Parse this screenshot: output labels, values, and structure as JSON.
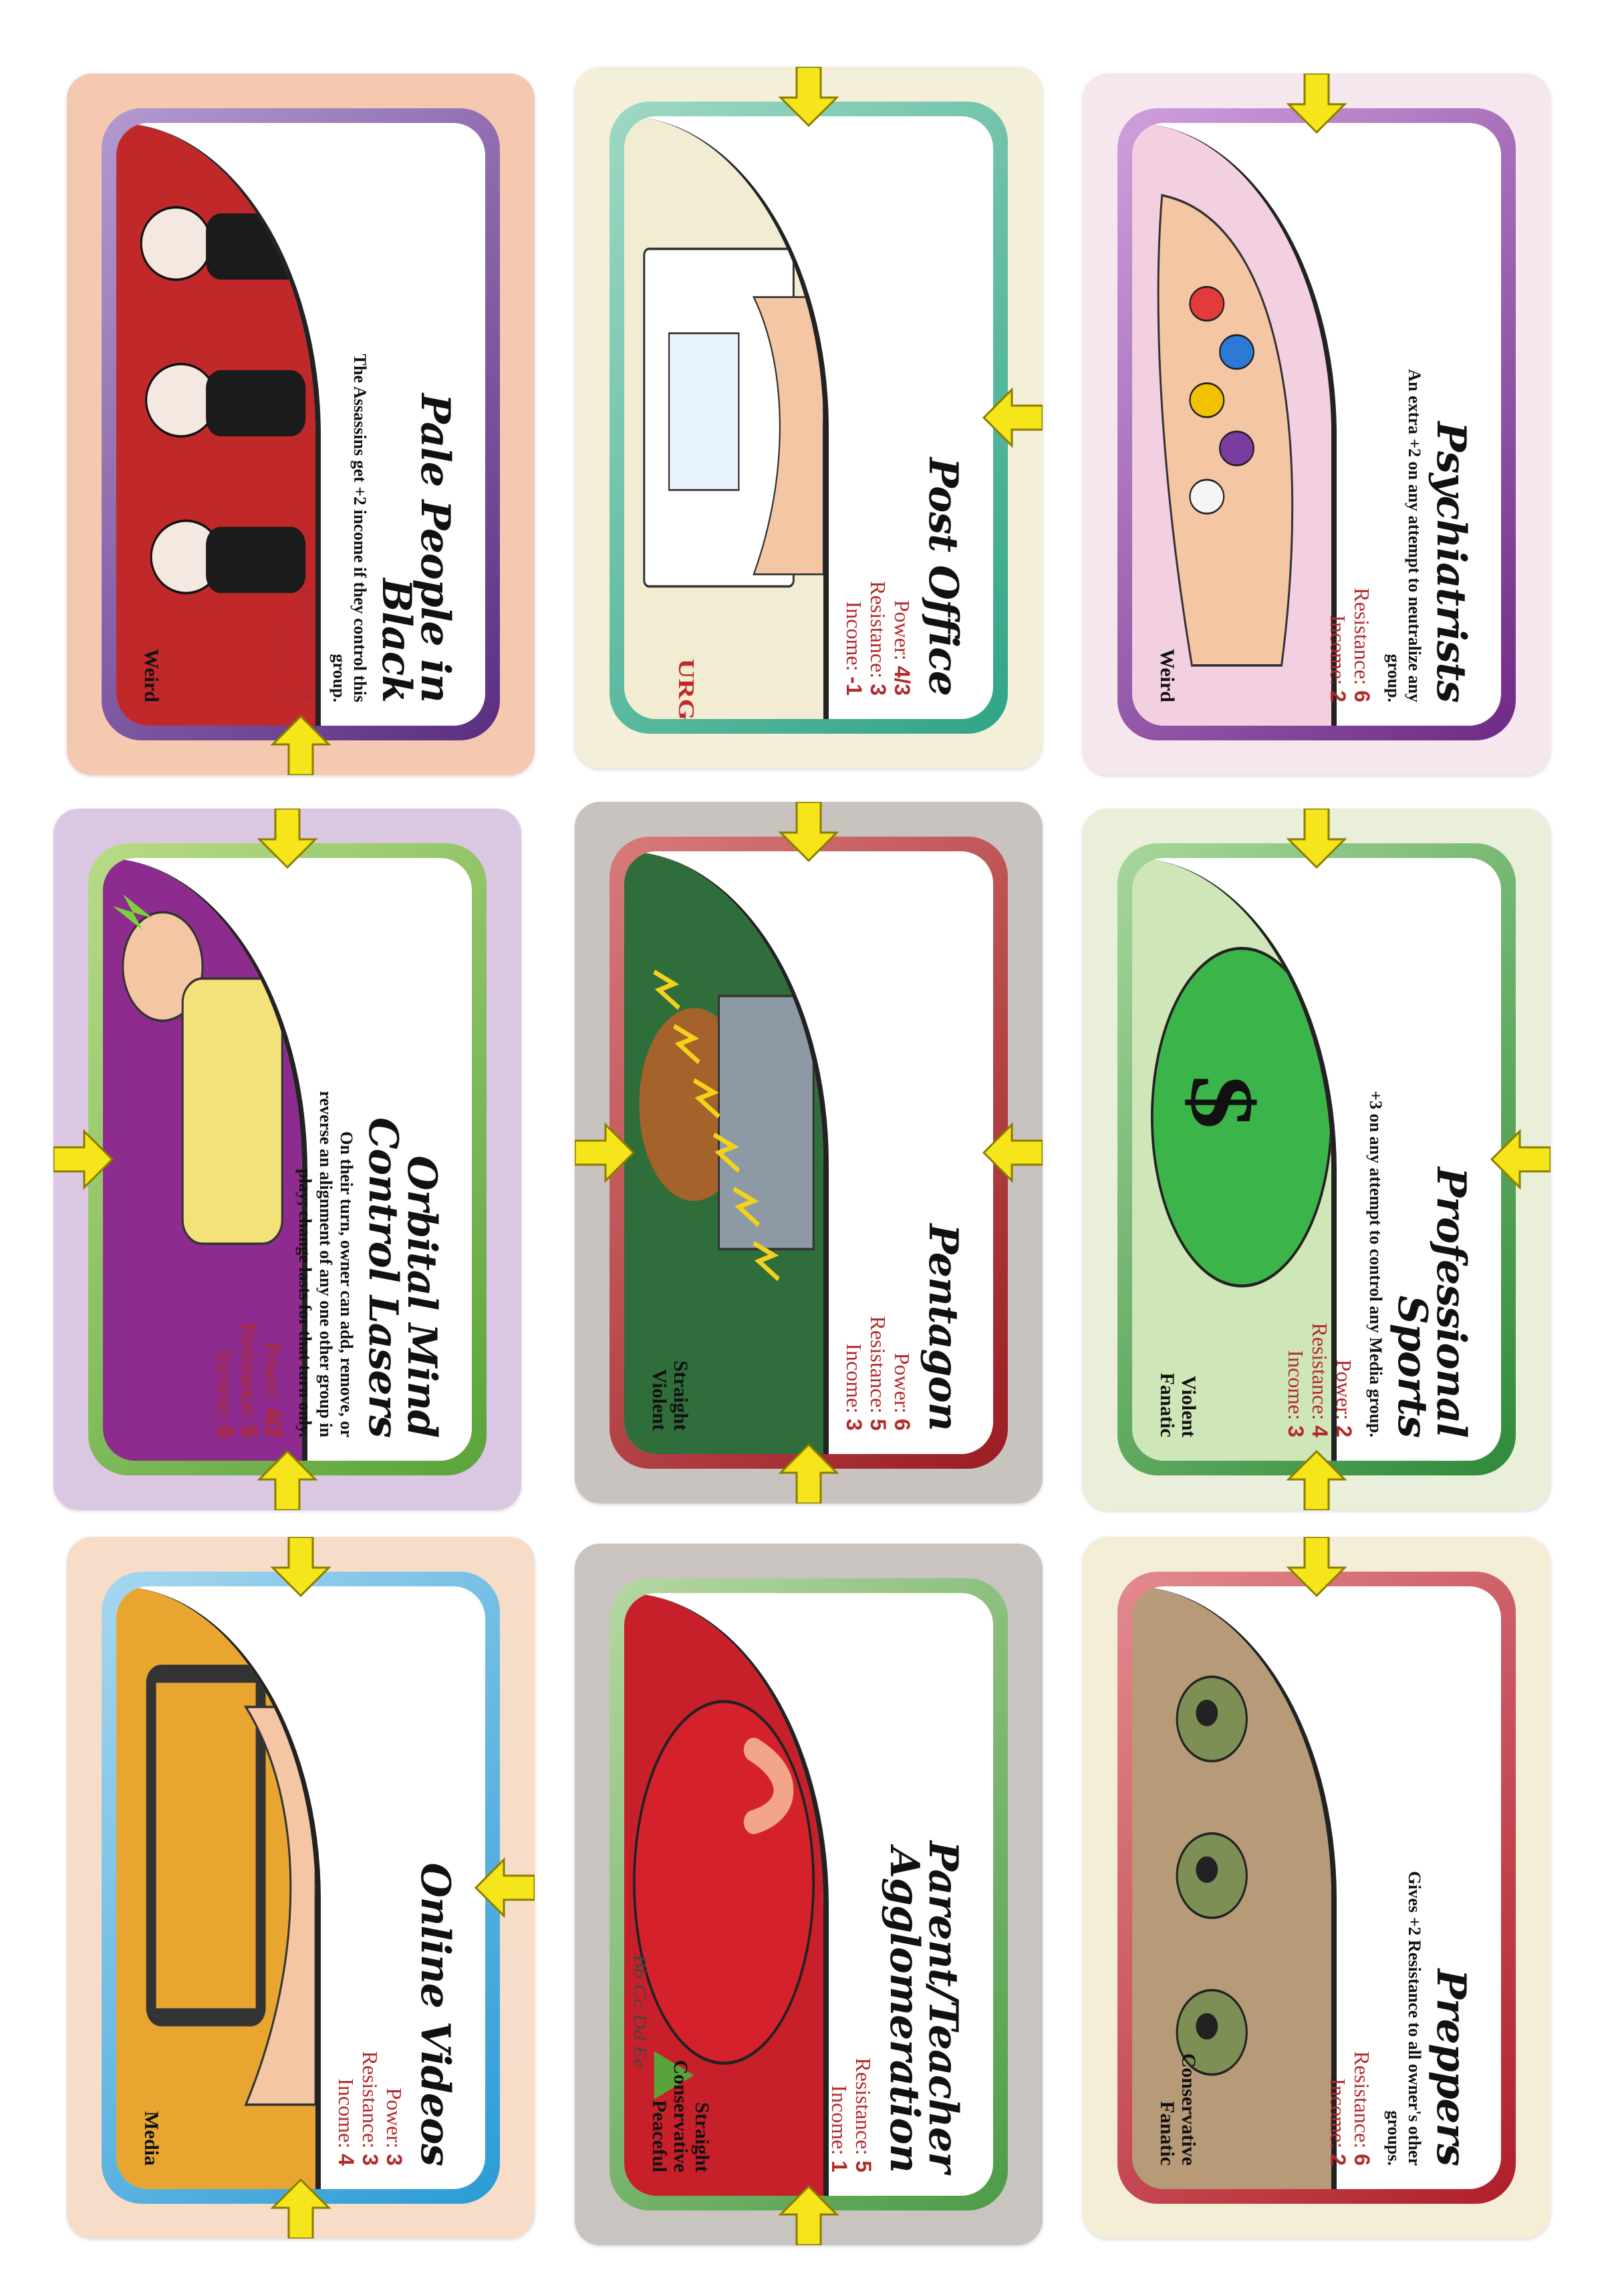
{
  "colors": {
    "stat_red": "#b32a2a",
    "arrow_yellow": "#f6e51b",
    "arrow_outline": "#8a7d00"
  },
  "cards": [
    {
      "id": "pale-people",
      "title": "Pale People in Black",
      "description": "The Assassins get +2 income if they control this group.",
      "stats": [
        {
          "label": "Resistance:",
          "value": "1"
        },
        {
          "label": "Income:",
          "value": "2"
        }
      ],
      "alignments": [
        "Weird"
      ],
      "card_bg": "#f5c8b0",
      "frame": "#5b2d82",
      "frame2": "#b39ad0",
      "art_bg": "#c0282a",
      "arrows": [
        "bottom"
      ]
    },
    {
      "id": "post-office",
      "title": "Post Office",
      "description": "",
      "stats": [
        {
          "label": "Power:",
          "value": "4/3"
        },
        {
          "label": "Resistance:",
          "value": "3"
        },
        {
          "label": "Income:",
          "value": "-1"
        }
      ],
      "alignments": [],
      "art_label": "URGENT",
      "card_bg": "#f4efd8",
      "frame": "#2fa486",
      "frame2": "#9ed9c4",
      "art_bg": "#f1ecd2",
      "arrows": [
        "top",
        "right"
      ]
    },
    {
      "id": "psychiatrists",
      "title": "Psychiatrists",
      "description": "An extra +2 on any attempt to neutralize any group.",
      "stats": [
        {
          "label": "Resistance:",
          "value": "6"
        },
        {
          "label": "Income:",
          "value": "2"
        }
      ],
      "alignments": [
        "Weird"
      ],
      "card_bg": "#f6e7ee",
      "frame": "#6e2a86",
      "frame2": "#cfa0dd",
      "art_bg": "#f3cfe2",
      "arrows": [
        "top"
      ]
    },
    {
      "id": "orbital-lasers",
      "title": "Orbital Mind Control Lasers",
      "description": "On their turn, owner can add, remove, or reverse an alignment of any one other group in play; change lasts for that turn only.",
      "stats": [
        {
          "label": "Power:",
          "value": "4/2"
        },
        {
          "label": "Resistance:",
          "value": "5"
        },
        {
          "label": "Income:",
          "value": "0"
        }
      ],
      "alignments": [],
      "card_bg": "#dcc7e3",
      "frame": "#5aa33a",
      "frame2": "#b7dc86",
      "art_bg": "#8e2b8e",
      "arrows": [
        "left",
        "bottom",
        "top"
      ]
    },
    {
      "id": "pentagon",
      "title": "Pentagon",
      "description": "",
      "stats": [
        {
          "label": "Power:",
          "value": "6"
        },
        {
          "label": "Resistance:",
          "value": "5"
        },
        {
          "label": "Income:",
          "value": "3"
        }
      ],
      "alignments": [
        "Straight",
        "Violent"
      ],
      "card_bg": "#c9c3c0",
      "frame": "#9a1c22",
      "frame2": "#d87b7b",
      "art_bg": "#2f6d3a",
      "arrows": [
        "top",
        "left",
        "right",
        "bottom"
      ]
    },
    {
      "id": "pro-sports",
      "title": "Professional Sports",
      "description": "+3 on any attempt to control any Media group.",
      "stats": [
        {
          "label": "Power:",
          "value": "2"
        },
        {
          "label": "Resistance:",
          "value": "4"
        },
        {
          "label": "Income:",
          "value": "3"
        }
      ],
      "alignments": [
        "Violent",
        "Fanatic"
      ],
      "card_bg": "#e9efd9",
      "frame": "#2f8a3a",
      "frame2": "#a7d79a",
      "art_bg": "#cfe6b9",
      "arrows": [
        "top",
        "right",
        "bottom"
      ]
    },
    {
      "id": "online-videos",
      "title": "Online Videos",
      "description": "",
      "stats": [
        {
          "label": "Power:",
          "value": "3"
        },
        {
          "label": "Resistance:",
          "value": "3"
        },
        {
          "label": "Income:",
          "value": "4"
        }
      ],
      "alignments": [
        "Media"
      ],
      "card_bg": "#f7dcc8",
      "frame": "#2a9bd6",
      "frame2": "#a7d7ef",
      "art_bg": "#e8a630",
      "arrows": [
        "top",
        "right",
        "bottom"
      ]
    },
    {
      "id": "parent-teacher",
      "title": "Parent/Teacher Agglomeration",
      "description": "",
      "stats": [
        {
          "label": "Resistance:",
          "value": "5"
        },
        {
          "label": "Income:",
          "value": "1"
        }
      ],
      "alignments": [
        "Straight",
        "Conservative",
        "Peaceful"
      ],
      "art_label": "Bb Cc Dd Ee",
      "card_bg": "#c9c4bf",
      "frame": "#4c9c47",
      "frame2": "#b5d7a1",
      "art_bg": "#c8202a",
      "arrows": [
        "bottom"
      ]
    },
    {
      "id": "preppers",
      "title": "Preppers",
      "description": "Gives +2 Resistance to all owner's other groups.",
      "stats": [
        {
          "label": "Resistance:",
          "value": "6"
        },
        {
          "label": "Income:",
          "value": "2"
        }
      ],
      "alignments": [
        "Conservative",
        "Fanatic"
      ],
      "card_bg": "#f4eed6",
      "frame": "#b01d2a",
      "frame2": "#e38b8f",
      "art_bg": "#9ab07a",
      "arrows": [
        "top"
      ]
    }
  ]
}
